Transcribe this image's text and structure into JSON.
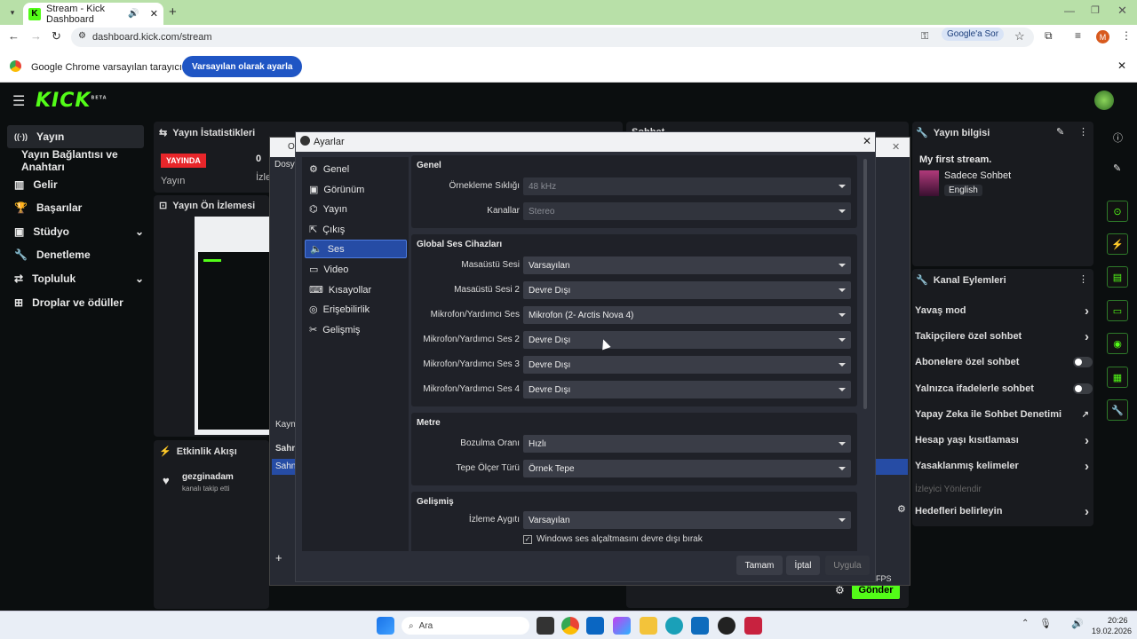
{
  "browser": {
    "tab_title": "Stream - Kick Dashboard",
    "url": "dashboard.kick.com/stream",
    "search_button": "Google'a Sor",
    "profile_initial": "M",
    "infobar_text": "Google Chrome varsayılan tarayıcınız değil",
    "infobar_button": "Varsayılan olarak ayarla"
  },
  "kick": {
    "logo": "KICK",
    "logo_badge": "BETA",
    "nav": [
      {
        "label": "Yayın",
        "icon": "broadcast-icon"
      },
      {
        "label": "Yayın Bağlantısı ve Anahtarı",
        "icon": ""
      },
      {
        "label": "Gelir",
        "icon": "chart-icon"
      },
      {
        "label": "Başarılar",
        "icon": "trophy-icon"
      },
      {
        "label": "Stüdyo",
        "icon": "studio-icon"
      },
      {
        "label": "Denetleme",
        "icon": "wrench-icon"
      },
      {
        "label": "Topluluk",
        "icon": "community-icon"
      },
      {
        "label": "Droplar ve ödüller",
        "icon": "gift-icon"
      }
    ],
    "stats": {
      "title": "Yayın İstatistikleri",
      "live_badge": "YAYINDA",
      "live_label": "Yayın",
      "viewer_count": "0",
      "viewer_label": "İzle"
    },
    "preview": {
      "title": "Yayın Ön İzlemesi"
    },
    "chat": {
      "title": "Sohbet",
      "send": "Gönder"
    },
    "activity": {
      "title": "Etkinlik Akışı",
      "user": "gezginadam",
      "action": "kanalı takip etti"
    },
    "stream_info": {
      "title": "Yayın bilgisi",
      "stream_title": "My first stream.",
      "category": "Sadece Sohbet",
      "language": "English"
    },
    "actions": {
      "title": "Kanal Eylemleri",
      "items": [
        {
          "label": "Yavaş mod",
          "control": "arrow"
        },
        {
          "label": "Takipçilere özel sohbet",
          "control": "arrow"
        },
        {
          "label": "Abonelere özel sohbet",
          "control": "toggle"
        },
        {
          "label": "Yalnızca ifadelerle sohbet",
          "control": "toggle"
        },
        {
          "label": "Yapay Zeka ile Sohbet Denetimi",
          "control": "external"
        },
        {
          "label": "Hesap yaşı kısıtlaması",
          "control": "arrow"
        },
        {
          "label": "Yasaklanmış kelimeler",
          "control": "arrow"
        },
        {
          "label": "İzleyici Yönlendir",
          "control": "none"
        },
        {
          "label": "Hedefleri belirleyin",
          "control": "arrow"
        }
      ]
    }
  },
  "obs_bg": {
    "title": "OB",
    "menu": "Dosya",
    "sources_label": "Kayna",
    "scenes_label": "Sahn",
    "scene_item": "Sahn",
    "fps": "FPS"
  },
  "settings": {
    "title": "Ayarlar",
    "sidebar": [
      {
        "label": "Genel",
        "icon": "gear-icon"
      },
      {
        "label": "Görünüm",
        "icon": "appearance-icon"
      },
      {
        "label": "Yayın",
        "icon": "antenna-icon"
      },
      {
        "label": "Çıkış",
        "icon": "output-icon"
      },
      {
        "label": "Ses",
        "icon": "speaker-icon"
      },
      {
        "label": "Video",
        "icon": "monitor-icon"
      },
      {
        "label": "Kısayollar",
        "icon": "keyboard-icon"
      },
      {
        "label": "Erişebilirlik",
        "icon": "accessibility-icon"
      },
      {
        "label": "Gelişmiş",
        "icon": "tools-icon"
      }
    ],
    "selected": "Ses",
    "sections": {
      "general": {
        "title": "Genel",
        "fields": [
          {
            "label": "Örnekleme Sıklığı",
            "value": "48 kHz"
          },
          {
            "label": "Kanallar",
            "value": "Stereo"
          }
        ]
      },
      "global": {
        "title": "Global Ses Cihazları",
        "fields": [
          {
            "label": "Masaüstü Sesi",
            "value": "Varsayılan"
          },
          {
            "label": "Masaüstü Sesi 2",
            "value": "Devre Dışı"
          },
          {
            "label": "Mikrofon/Yardımcı Ses",
            "value": "Mikrofon (2- Arctis Nova 4)"
          },
          {
            "label": "Mikrofon/Yardımcı Ses 2",
            "value": "Devre Dışı"
          },
          {
            "label": "Mikrofon/Yardımcı Ses 3",
            "value": "Devre Dışı"
          },
          {
            "label": "Mikrofon/Yardımcı Ses 4",
            "value": "Devre Dışı"
          }
        ]
      },
      "meters": {
        "title": "Metre",
        "fields": [
          {
            "label": "Bozulma Oranı",
            "value": "Hızlı"
          },
          {
            "label": "Tepe Ölçer Türü",
            "value": "Örnek Tepe"
          }
        ]
      },
      "advanced": {
        "title": "Gelişmiş",
        "fields": [
          {
            "label": "İzleme Aygıtı",
            "value": "Varsayılan"
          }
        ],
        "checkbox": "Windows ses alçaltmasını devre dışı bırak"
      }
    },
    "buttons": {
      "ok": "Tamam",
      "cancel": "İptal",
      "apply": "Uygula"
    }
  },
  "taskbar": {
    "search": "Ara",
    "time": "20:26",
    "date": "19.02.2026"
  },
  "colors": {
    "kick_green": "#53fc18",
    "live_red": "#e8262a",
    "selected_blue": "#264ca5"
  }
}
